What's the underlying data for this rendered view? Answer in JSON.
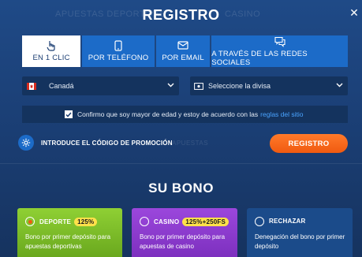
{
  "page": {
    "title": "REGISTRO"
  },
  "background_text": {
    "left": "APUESTAS DEPORTIVAS",
    "right": "CASINO"
  },
  "tabs": [
    {
      "label": "EN 1 CLIC",
      "icon": "pointer-icon",
      "active": true
    },
    {
      "label": "POR TELÉFONO",
      "icon": "phone-icon",
      "active": false
    },
    {
      "label": "POR EMAIL",
      "icon": "email-icon",
      "active": false
    },
    {
      "label": "A TRAVÉS DE LAS REDES SOCIALES",
      "icon": "chat-icon",
      "active": false
    }
  ],
  "country": {
    "value": "Canadá",
    "flag": "canada-flag-icon"
  },
  "currency": {
    "placeholder": "Seleccione la divisa",
    "icon": "money-icon"
  },
  "confirm": {
    "checked": true,
    "text": "Confirmo que soy mayor de edad y estoy de acuerdo con las",
    "link": "reglas del sitio"
  },
  "promo": {
    "label": "INTRODUCE EL CÓDIGO DE PROMOCIÓN",
    "faint": "APUESTAS"
  },
  "register_button": "REGISTRO",
  "bonus": {
    "title": "SU BONO",
    "options": [
      {
        "label": "DEPORTE",
        "badge": "125%",
        "desc": "Bono por primer depósito para apuestas deportivas",
        "selected": true,
        "color": "#7fbf2a"
      },
      {
        "label": "CASINO",
        "badge": "125%+250FS",
        "desc": "Bono por primer depósito para apuestas de casino",
        "selected": false,
        "color": "#8e3fd0"
      },
      {
        "label": "RECHAZAR",
        "badge": "",
        "desc": "Denegación del bono por primer depósito",
        "selected": false,
        "color": "#1a4c8c"
      }
    ]
  },
  "colors": {
    "accent": "#1c6bc8",
    "cta": "#f05a10",
    "link": "#4aa3ff"
  }
}
